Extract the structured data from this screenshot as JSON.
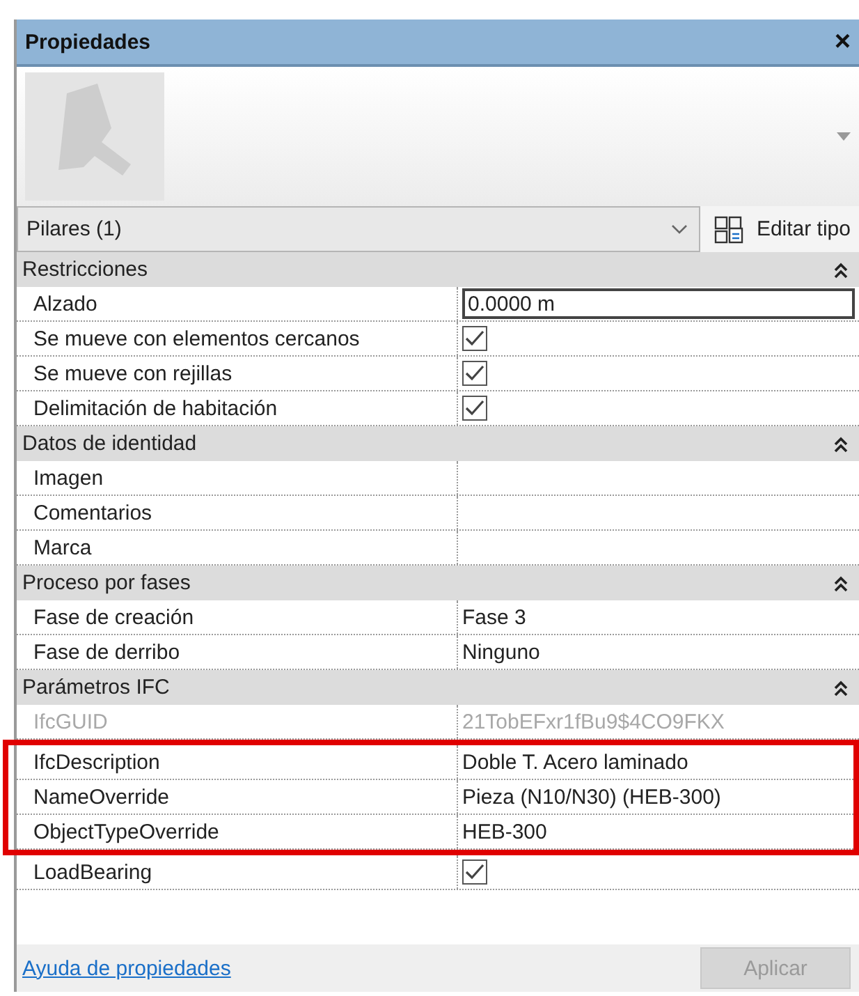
{
  "window": {
    "title": "Propiedades",
    "close": "×"
  },
  "type_selector": {
    "value": "Pilares (1)",
    "edit_type": "Editar tipo"
  },
  "groups": [
    {
      "title": "Restricciones",
      "expanded": true,
      "rows": [
        {
          "label": "Alzado",
          "kind": "input",
          "value": "0.0000 m",
          "disabled": false,
          "highlighted": false
        },
        {
          "label": "Se mueve con elementos cercanos",
          "kind": "check",
          "checked": true,
          "disabled": false,
          "highlighted": false
        },
        {
          "label": "Se mueve con rejillas",
          "kind": "check",
          "checked": true,
          "disabled": false,
          "highlighted": false
        },
        {
          "label": "Delimitación de habitación",
          "kind": "check",
          "checked": true,
          "disabled": false,
          "highlighted": false
        }
      ]
    },
    {
      "title": "Datos de identidad",
      "expanded": true,
      "rows": [
        {
          "label": "Imagen",
          "kind": "text",
          "disabled": false,
          "highlighted": false
        },
        {
          "label": "Comentarios",
          "kind": "text",
          "disabled": false,
          "highlighted": false
        },
        {
          "label": "Marca",
          "kind": "text",
          "disabled": false,
          "highlighted": false
        }
      ]
    },
    {
      "title": "Proceso por fases",
      "expanded": true,
      "rows": [
        {
          "label": "Fase de creación",
          "kind": "text",
          "value": "Fase 3",
          "disabled": false,
          "highlighted": false
        },
        {
          "label": "Fase de derribo",
          "kind": "text",
          "value": "Ninguno",
          "disabled": false,
          "highlighted": false
        }
      ]
    },
    {
      "title": "Parámetros IFC",
      "expanded": true,
      "rows": [
        {
          "label": "IfcGUID",
          "kind": "text",
          "value": "21TobEFxr1fBu9$4CO9FKX",
          "disabled": true,
          "highlighted": false
        },
        {
          "label": "IfcDescription",
          "kind": "text",
          "value": "Doble T. Acero laminado",
          "disabled": false,
          "highlighted": true
        },
        {
          "label": "NameOverride",
          "kind": "text",
          "value": "Pieza (N10/N30) (HEB-300)",
          "disabled": false,
          "highlighted": true
        },
        {
          "label": "ObjectTypeOverride",
          "kind": "text",
          "value": "HEB-300",
          "disabled": false,
          "highlighted": true
        },
        {
          "label": "LoadBearing",
          "kind": "check",
          "checked": true,
          "disabled": false,
          "highlighted": false
        }
      ]
    }
  ],
  "footer": {
    "help_link": "Ayuda de propiedades",
    "apply": {
      "label": "Aplicar",
      "disabled": true
    }
  }
}
